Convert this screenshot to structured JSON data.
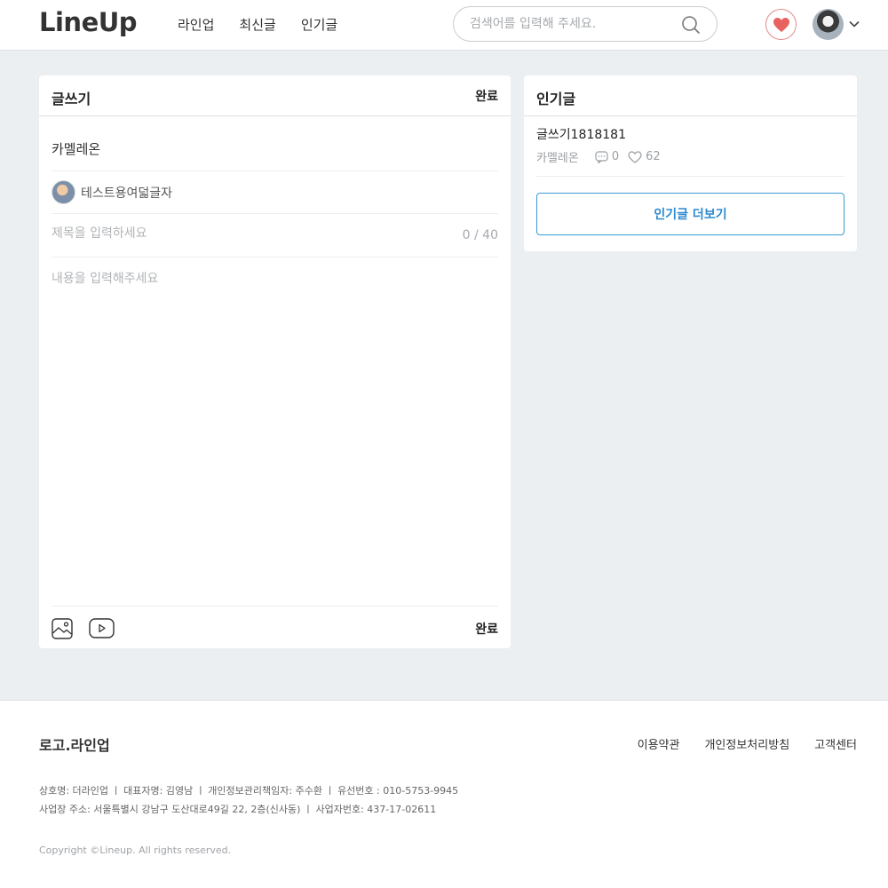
{
  "header": {
    "logo": "LineUp",
    "nav": [
      "라인업",
      "최신글",
      "인기글"
    ],
    "search_placeholder": "검색어를 입력해 주세요."
  },
  "editor": {
    "title": "글쓰기",
    "done_label": "완료",
    "category": "카멜레온",
    "author": "테스트용여덟글자",
    "title_placeholder": "제목을 입력하세요",
    "title_counter": "0 / 40",
    "content_placeholder": "내용을 입력해주세요",
    "done_bottom_label": "완료"
  },
  "popular": {
    "title": "인기글",
    "items": [
      {
        "title": "글쓰기1818181",
        "author": "카멜레온",
        "comments": "0",
        "likes": "62"
      }
    ],
    "more_label": "인기글 더보기"
  },
  "footer": {
    "logo": "로고.라인업",
    "links": [
      "이용약관",
      "개인정보처리방침",
      "고객센터"
    ],
    "info_line1": "상호명: 더라인업 ㅣ 대표자명: 김영남 ㅣ 개인정보관리책임자: 주수환 ㅣ 유선번호 : 010-5753-9945",
    "info_line2": "사업장 주소: 서울특별시 강남구 도산대로49길 22, 2층(신사동) ㅣ 사업자번호: 437-17-02611",
    "copyright": "Copyright ©Lineup. All rights reserved."
  },
  "colors": {
    "accent": "#2c8ad0",
    "heart": "#e8625f",
    "background": "#eceff2"
  }
}
